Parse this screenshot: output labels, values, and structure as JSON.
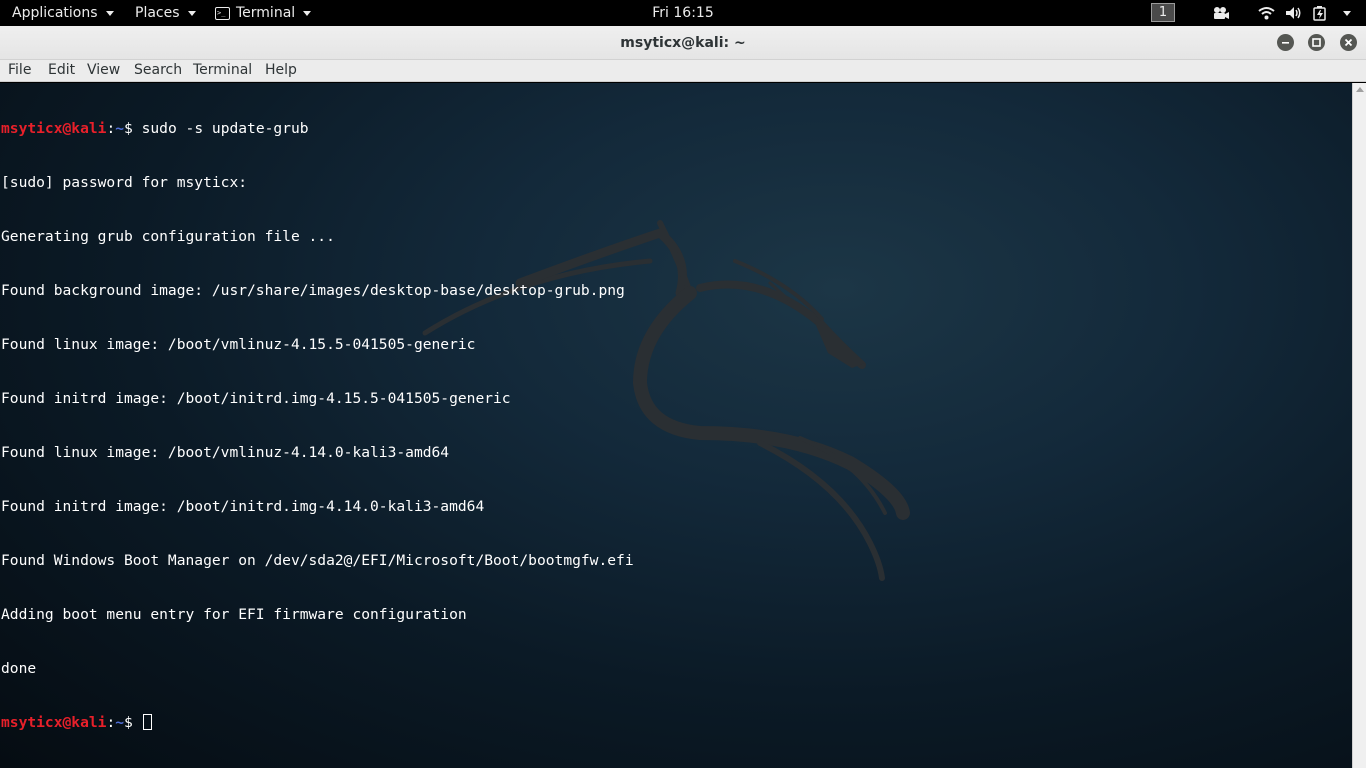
{
  "top_bar": {
    "applications_label": "Applications",
    "places_label": "Places",
    "terminal_app_label": "Terminal",
    "clock": "Fri 16:15",
    "workspace_number": "1",
    "tray_icons": [
      "video-camera-icon",
      "wifi-icon",
      "volume-icon",
      "battery-icon",
      "power-menu-icon"
    ]
  },
  "window": {
    "title": "msyticx@kali: ~",
    "controls": [
      "minimize-icon",
      "maximize-icon",
      "close-icon"
    ]
  },
  "menubar": {
    "file": "File",
    "edit": "Edit",
    "view": "View",
    "search": "Search",
    "terminal": "Terminal",
    "help": "Help"
  },
  "terminal": {
    "prompt_user": "msyticx@kali",
    "prompt_sep": ":",
    "prompt_path": "~",
    "prompt_symbol": "$",
    "command": " sudo -s update-grub",
    "output_lines": [
      "[sudo] password for msyticx:",
      "Generating grub configuration file ...",
      "Found background image: /usr/share/images/desktop-base/desktop-grub.png",
      "Found linux image: /boot/vmlinuz-4.15.5-041505-generic",
      "Found initrd image: /boot/initrd.img-4.15.5-041505-generic",
      "Found linux image: /boot/vmlinuz-4.14.0-kali3-amd64",
      "Found initrd image: /boot/initrd.img-4.14.0-kali3-amd64",
      "Found Windows Boot Manager on /dev/sda2@/EFI/Microsoft/Boot/bootmgfw.efi",
      "Adding boot menu entry for EFI firmware configuration",
      "done"
    ],
    "colors": {
      "prompt_user": "#e8202a",
      "prompt_path": "#4f6fd8",
      "text": "#ffffff",
      "background": "#0b1a26"
    }
  }
}
